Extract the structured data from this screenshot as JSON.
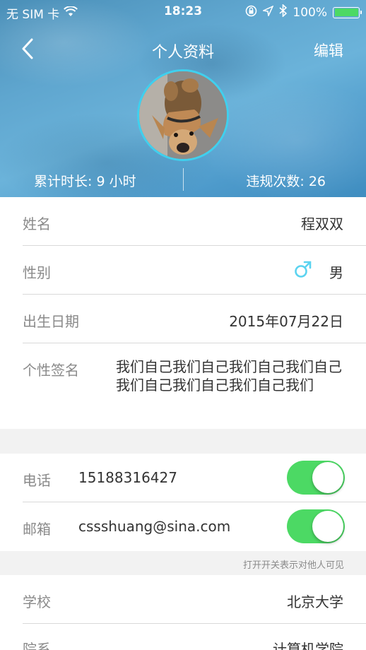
{
  "status_bar": {
    "carrier": "无 SIM 卡",
    "time": "18:23",
    "battery": "100%"
  },
  "nav": {
    "title": "个人资料",
    "edit_label": "编辑"
  },
  "stats": {
    "duration": "累计时长: 9 小时",
    "violations": "违规次数:  26"
  },
  "profile": {
    "name_label": "姓名",
    "name_value": "程双双",
    "gender_label": "性别",
    "gender_icon": "male-symbol-icon",
    "gender_value": "男",
    "birthday_label": "出生日期",
    "birthday_value": "2015年07月22日",
    "signature_label": "个性签名",
    "signature_value": "我们自己我们自己我们自己我们自己我们自己我们自己我们自己我们"
  },
  "contact": {
    "phone_label": "电话",
    "phone_value": "15188316427",
    "phone_visible": true,
    "email_label": "邮箱",
    "email_value": "cssshuang@sina.com",
    "email_visible": true,
    "hint": "打开开关表示对他人可见"
  },
  "school": {
    "school_label": "学校",
    "school_value": "北京大学",
    "department_label": "院系",
    "department_value": "计算机学院"
  },
  "colors": {
    "accent_cyan": "#3fd0ee",
    "toggle_on": "#4cd964",
    "gender_male": "#5bd3f0"
  }
}
